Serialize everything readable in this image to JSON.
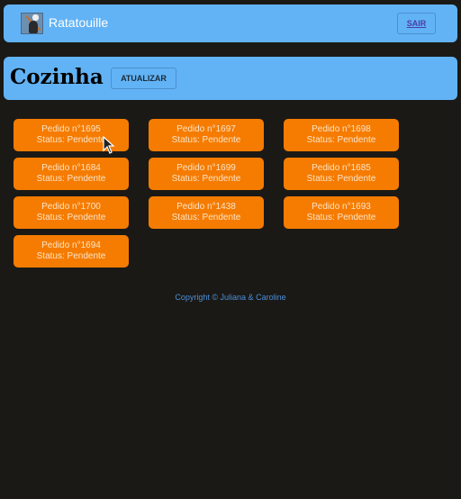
{
  "header": {
    "title": "Ratatouille",
    "logout_label": "SAIR"
  },
  "section": {
    "title": "Cozinha",
    "refresh_label": "ATUALIZAR"
  },
  "orders": [
    {
      "number": "Pedido n°1695",
      "status": "Status: Pendente"
    },
    {
      "number": "Pedido n°1697",
      "status": "Status: Pendente"
    },
    {
      "number": "Pedido n°1698",
      "status": "Status: Pendente"
    },
    {
      "number": "Pedido n°1684",
      "status": "Status: Pendente"
    },
    {
      "number": "Pedido n°1699",
      "status": "Status: Pendente"
    },
    {
      "number": "Pedido n°1685",
      "status": "Status: Pendente"
    },
    {
      "number": "Pedido n°1700",
      "status": "Status: Pendente"
    },
    {
      "number": "Pedido n°1438",
      "status": "Status: Pendente"
    },
    {
      "number": "Pedido n°1693",
      "status": "Status: Pendente"
    },
    {
      "number": "Pedido n°1694",
      "status": "Status: Pendente"
    }
  ],
  "footer": {
    "copyright": "Copyright © Juliana & Caroline"
  },
  "colors": {
    "bar": "#62b3f5",
    "card": "#f57c00",
    "background": "#1b1916"
  }
}
